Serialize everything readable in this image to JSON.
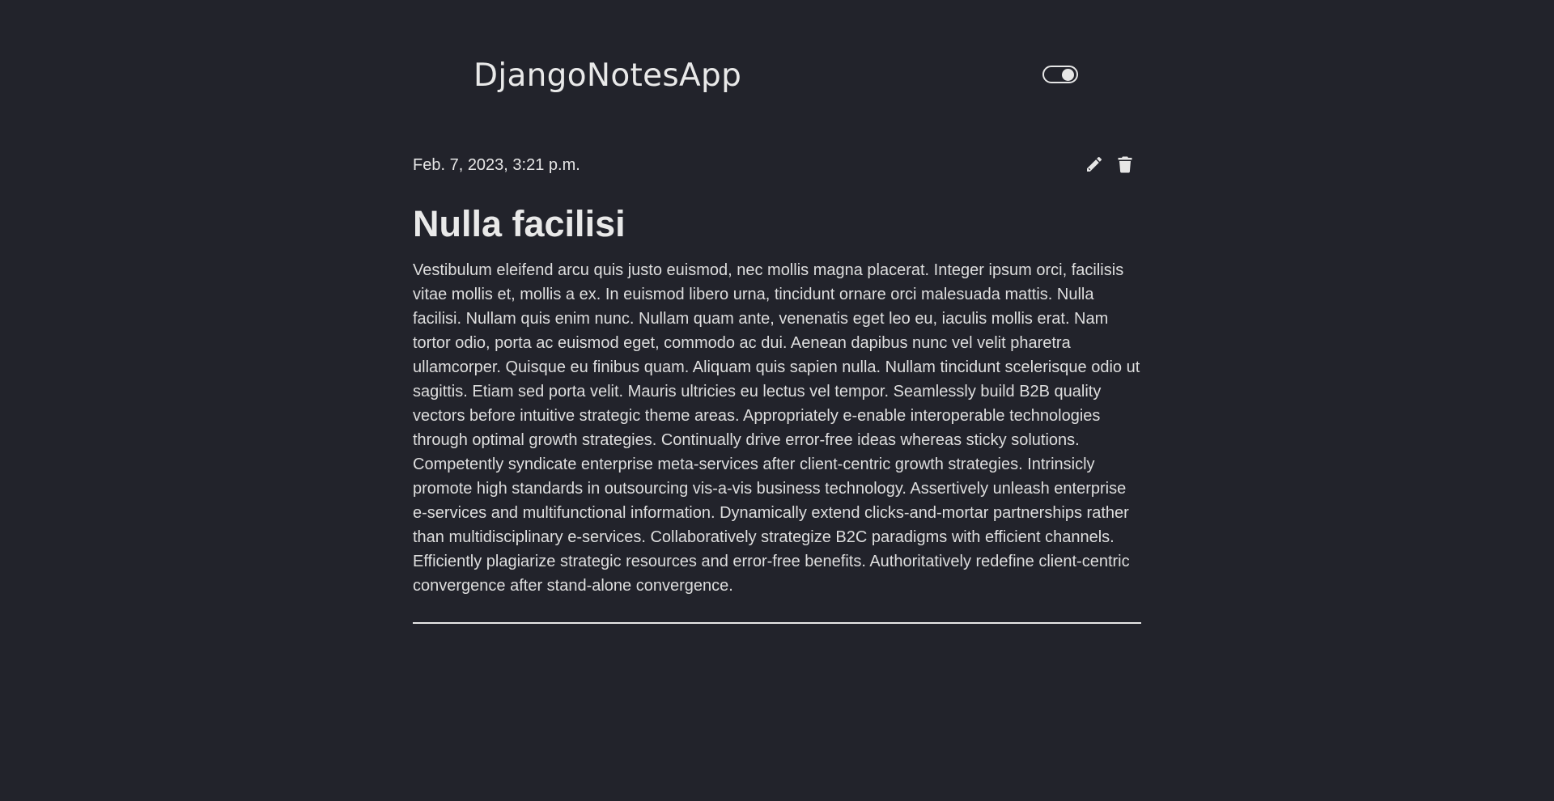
{
  "app": {
    "title": "DjangoNotesApp"
  },
  "header": {
    "theme_toggle": {
      "state": "on"
    }
  },
  "note": {
    "date": "Feb. 7, 2023, 3:21 p.m.",
    "title": "Nulla facilisi",
    "body": "Vestibulum eleifend arcu quis justo euismod, nec mollis magna placerat. Integer ipsum orci, facilisis vitae mollis et, mollis a ex. In euismod libero urna, tincidunt ornare orci malesuada mattis. Nulla facilisi. Nullam quis enim nunc. Nullam quam ante, venenatis eget leo eu, iaculis mollis erat. Nam tortor odio, porta ac euismod eget, commodo ac dui. Aenean dapibus nunc vel velit pharetra ullamcorper. Quisque eu finibus quam. Aliquam quis sapien nulla. Nullam tincidunt scelerisque odio ut sagittis. Etiam sed porta velit. Mauris ultricies eu lectus vel tempor. Seamlessly build B2B quality vectors before intuitive strategic theme areas. Appropriately e-enable interoperable technologies through optimal growth strategies. Continually drive error-free ideas whereas sticky solutions. Competently syndicate enterprise meta-services after client-centric growth strategies. Intrinsicly promote high standards in outsourcing vis-a-vis business technology. Assertively unleash enterprise e-services and multifunctional information. Dynamically extend clicks-and-mortar partnerships rather than multidisciplinary e-services. Collaboratively strategize B2C paradigms with efficient channels. Efficiently plagiarize strategic resources and error-free benefits. Authoritatively redefine client-centric convergence after stand-alone convergence.",
    "actions": {
      "edit_icon": "pencil-icon",
      "delete_icon": "trash-icon"
    }
  },
  "colors": {
    "background": "#22232b",
    "text": "#e6e6e6"
  }
}
